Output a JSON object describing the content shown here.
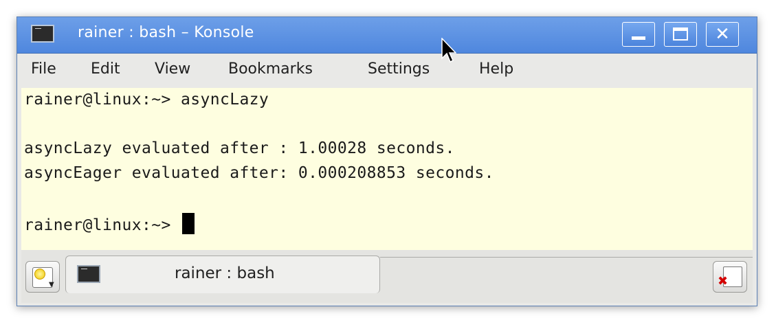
{
  "window": {
    "title": "rainer : bash – Konsole",
    "buttons": {
      "minimize": "minimize",
      "maximize": "maximize",
      "close": "close"
    }
  },
  "menubar": {
    "items": [
      "File",
      "Edit",
      "View",
      "Bookmarks",
      "Settings",
      "Help"
    ]
  },
  "terminal": {
    "background": "#fefee0",
    "lines": [
      "rainer@linux:~> asyncLazy",
      "",
      "asyncLazy evaluated after : 1.00028 seconds.",
      "asyncEager evaluated after: 0.000208853 seconds.",
      "",
      "rainer@linux:~> "
    ]
  },
  "tabs": {
    "items": [
      {
        "label": "rainer : bash",
        "icon": "terminal-icon"
      }
    ],
    "new_tab_icon": "new-tab-icon",
    "close_tab_icon": "close-tab-icon"
  },
  "colors": {
    "titlebar": "#5a90e2",
    "terminal_bg": "#fefee0",
    "menubar_bg": "#e9e9e7"
  }
}
